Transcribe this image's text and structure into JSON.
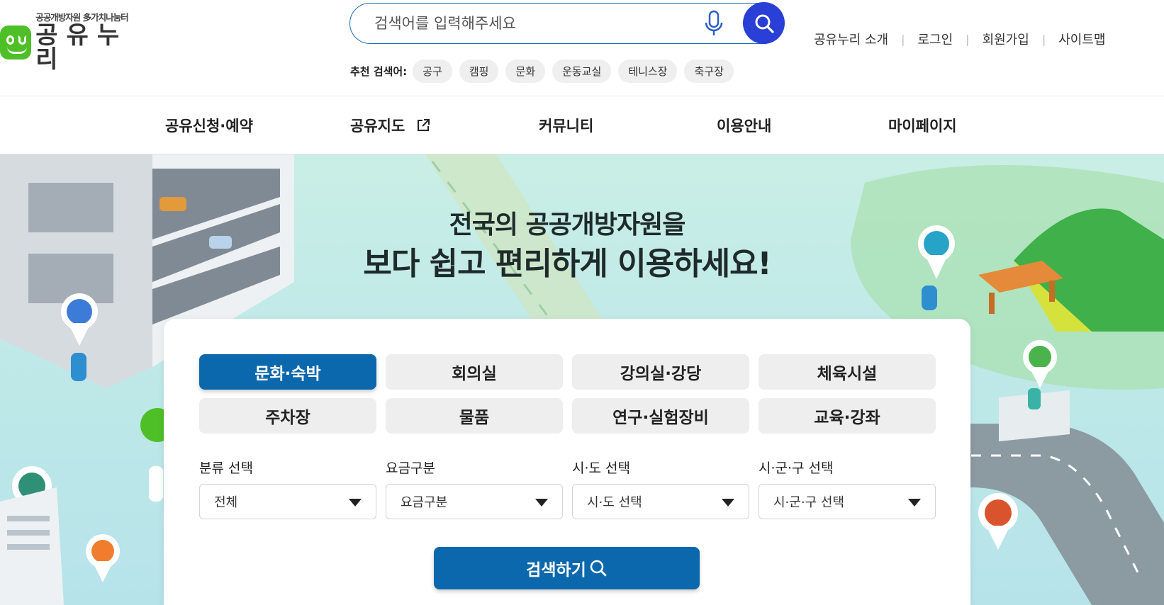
{
  "header": {
    "logo": {
      "sub": "공공개방자원 多가치나눔터",
      "main": "공유누리"
    },
    "search": {
      "placeholder": "검색어를 입력해주세요"
    },
    "recommend": {
      "label": "추천 검색어:",
      "chips": [
        "공구",
        "캠핑",
        "문화",
        "운동교실",
        "테니스장",
        "축구장"
      ]
    },
    "util_links": [
      "공유누리 소개",
      "로그인",
      "회원가입",
      "사이트맵"
    ]
  },
  "nav": {
    "items": [
      "공유신청·예약",
      "공유지도",
      "커뮤니티",
      "이용안내",
      "마이페이지"
    ]
  },
  "hero": {
    "title_line1": "전국의 공공개방자원을",
    "title_line2": "보다 쉽고 편리하게 이용하세요!"
  },
  "panel": {
    "categories": [
      "문화·숙박",
      "회의실",
      "강의실·강당",
      "체육시설",
      "주차장",
      "물품",
      "연구·실험장비",
      "교육·강좌"
    ],
    "active_category": "문화·숙박",
    "filters": [
      {
        "label": "분류 선택",
        "value": "전체"
      },
      {
        "label": "요금구분",
        "value": "요금구분"
      },
      {
        "label": "시·도 선택",
        "value": "시·도 선택"
      },
      {
        "label": "시·군·구 선택",
        "value": "시·군·구 선택"
      }
    ],
    "search_button": "검색하기"
  },
  "colors": {
    "primary": "#0c68ac",
    "search_button": "#2a3fd6",
    "brand_green": "#4fbf28",
    "hero_bg": "#c1eae8"
  }
}
